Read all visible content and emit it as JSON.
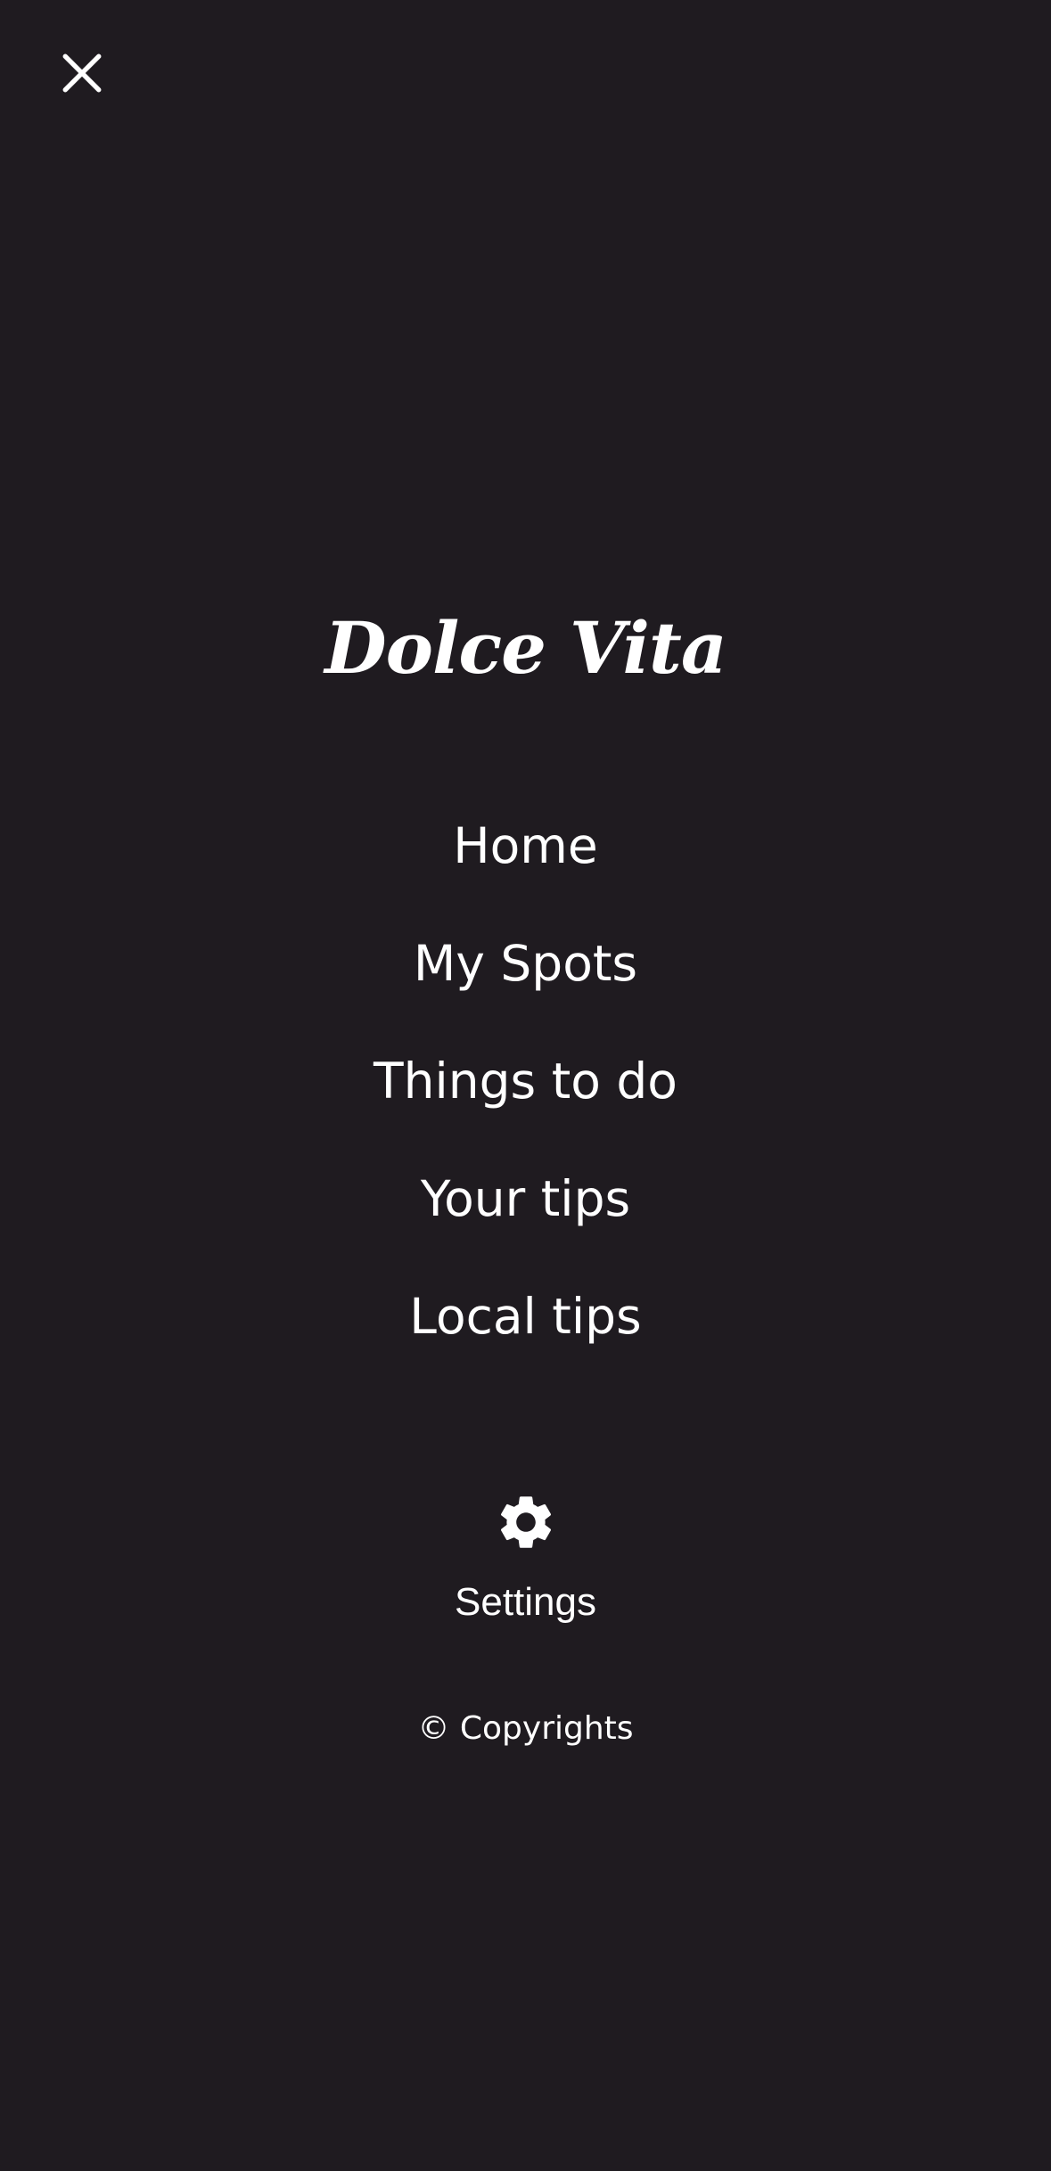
{
  "header": {
    "close_icon": "close-icon"
  },
  "brand": {
    "logo_text": "Dolce Vita"
  },
  "nav": {
    "items": [
      {
        "label": "Home"
      },
      {
        "label": "My Spots"
      },
      {
        "label": "Things to do"
      },
      {
        "label": "Your tips"
      },
      {
        "label": "Local tips"
      }
    ]
  },
  "settings": {
    "icon": "gear-icon",
    "label": "Settings"
  },
  "footer": {
    "copyright": "© Copyrights"
  },
  "colors": {
    "background": "#1f1b20",
    "text": "#ffffff"
  }
}
